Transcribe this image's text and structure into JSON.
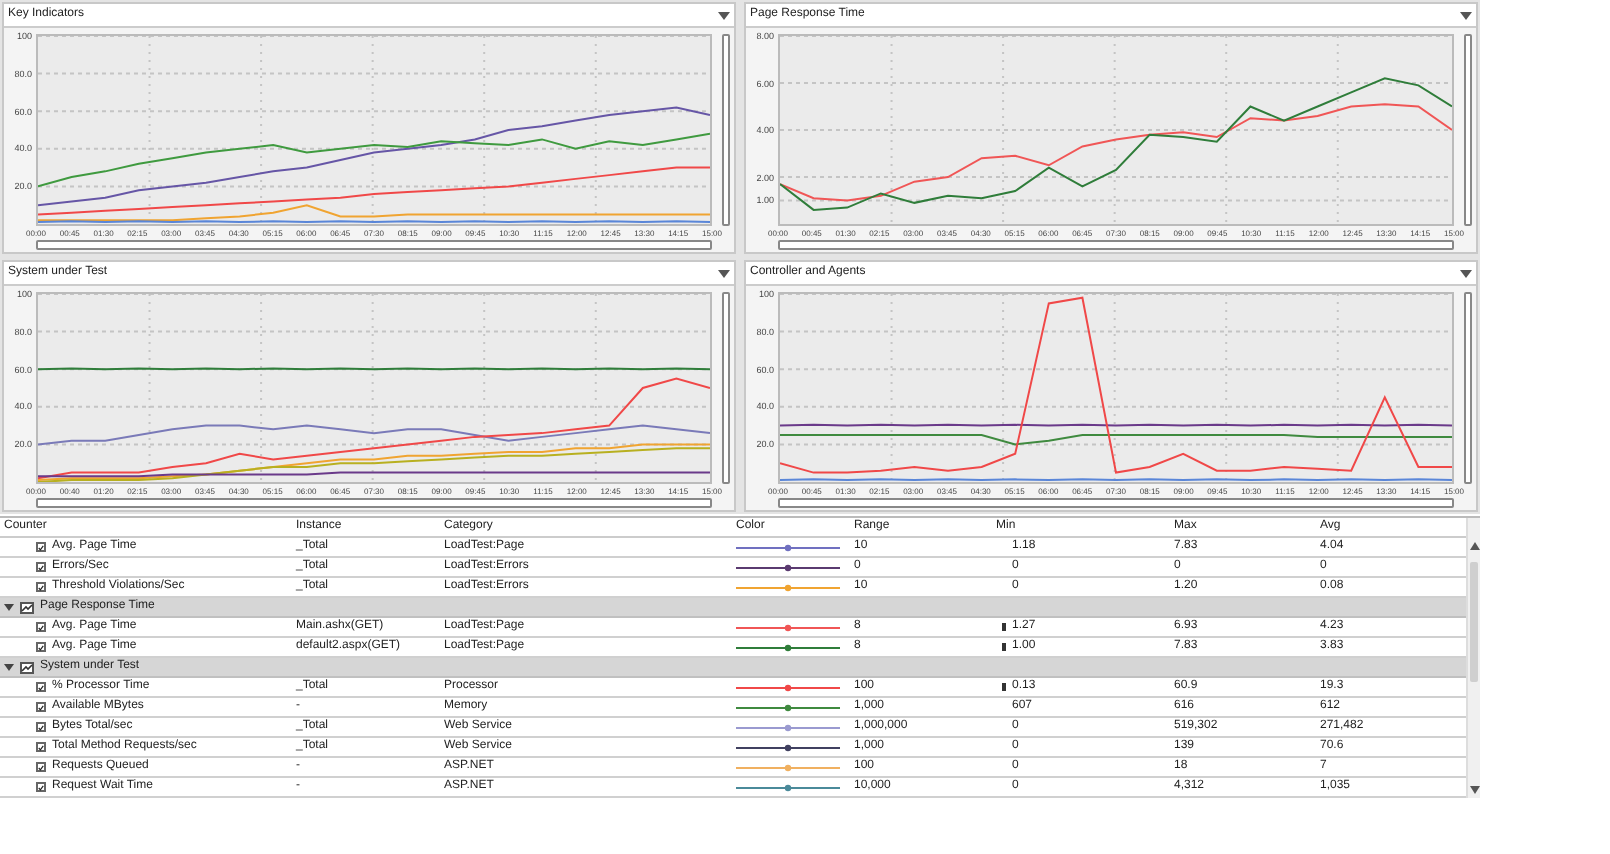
{
  "panels": [
    {
      "title": "Key Indicators",
      "chart_data": {
        "type": "line",
        "grid": true,
        "categories": [
          "00:00",
          "00:45",
          "01:30",
          "02:15",
          "03:00",
          "03:45",
          "04:30",
          "05:15",
          "06:00",
          "06:45",
          "07:30",
          "08:15",
          "09:00",
          "09:45",
          "10:30",
          "11:15",
          "12:00",
          "12:45",
          "13:30",
          "14:15",
          "15:00"
        ],
        "ylim": [
          0,
          100
        ],
        "yticks": [
          {
            "value": 100,
            "label": "100"
          },
          {
            "value": 80,
            "label": "80.0"
          },
          {
            "value": 60,
            "label": "60.0"
          },
          {
            "value": 40,
            "label": "40.0"
          },
          {
            "value": 20,
            "label": "20.0"
          }
        ],
        "series": [
          {
            "color": "#6656a6",
            "values": [
              10,
              12,
              14,
              18,
              20,
              22,
              25,
              28,
              30,
              34,
              38,
              40,
              42,
              45,
              50,
              52,
              55,
              58,
              60,
              62,
              58
            ]
          },
          {
            "color": "#3f9a3f",
            "values": [
              20,
              25,
              28,
              32,
              35,
              38,
              40,
              42,
              38,
              40,
              42,
              41,
              44,
              43,
              42,
              45,
              40,
              44,
              42,
              45,
              48
            ]
          },
          {
            "color": "#f04848",
            "values": [
              5,
              6,
              7,
              8,
              9,
              10,
              11,
              12,
              13,
              14,
              16,
              17,
              18,
              19,
              20,
              22,
              24,
              26,
              28,
              30,
              30
            ]
          },
          {
            "color": "#f0a431",
            "values": [
              2,
              2,
              2,
              2,
              2,
              3,
              4,
              6,
              10,
              4,
              4,
              5,
              5,
              5,
              5,
              5,
              5,
              5,
              5,
              5,
              5
            ]
          },
          {
            "color": "#5a86d8",
            "values": [
              1,
              1.4,
              1,
              1.4,
              1,
              1.4,
              1,
              1.4,
              1,
              1.4,
              1,
              1.4,
              1,
              1.4,
              1,
              1.4,
              1,
              1.4,
              1,
              1.4,
              1
            ]
          }
        ]
      }
    },
    {
      "title": "Page Response Time",
      "chart_data": {
        "type": "line",
        "grid": true,
        "categories": [
          "00:00",
          "00:45",
          "01:30",
          "02:15",
          "03:00",
          "03:45",
          "04:30",
          "05:15",
          "06:00",
          "06:45",
          "07:30",
          "08:15",
          "09:00",
          "09:45",
          "10:30",
          "11:15",
          "12:00",
          "12:45",
          "13:30",
          "14:15",
          "15:00"
        ],
        "ylim": [
          0,
          8
        ],
        "yticks": [
          {
            "value": 8,
            "label": "8.00"
          },
          {
            "value": 6,
            "label": "6.00"
          },
          {
            "value": 4,
            "label": "4.00"
          },
          {
            "value": 2,
            "label": "2.00"
          },
          {
            "value": 1,
            "label": "1.00"
          }
        ],
        "series": [
          {
            "color": "#f05656",
            "values": [
              1.7,
              1.1,
              1.0,
              1.2,
              1.8,
              2.0,
              2.8,
              2.9,
              2.5,
              3.3,
              3.6,
              3.8,
              3.9,
              3.7,
              4.5,
              4.4,
              4.6,
              5.0,
              5.1,
              5.0,
              4.0
            ]
          },
          {
            "color": "#2f7d3a",
            "values": [
              1.7,
              0.6,
              0.7,
              1.3,
              0.9,
              1.2,
              1.1,
              1.4,
              2.4,
              1.6,
              2.3,
              3.8,
              3.7,
              3.5,
              5.0,
              4.4,
              5.0,
              5.6,
              6.2,
              5.9,
              5.0
            ]
          }
        ]
      }
    },
    {
      "title": "System under Test",
      "chart_data": {
        "type": "line",
        "grid": true,
        "categories": [
          "00:00",
          "00:40",
          "01:20",
          "02:15",
          "03:00",
          "03:45",
          "04:30",
          "05:15",
          "06:00",
          "06:45",
          "07:30",
          "08:15",
          "09:00",
          "09:45",
          "10:30",
          "11:15",
          "12:00",
          "12:45",
          "13:30",
          "14:15",
          "15:00"
        ],
        "ylim": [
          0,
          100
        ],
        "yticks": [
          {
            "value": 100,
            "label": "100"
          },
          {
            "value": 80,
            "label": "80.0"
          },
          {
            "value": 60,
            "label": "60.0"
          },
          {
            "value": 40,
            "label": "40.0"
          },
          {
            "value": 20,
            "label": "20.0"
          }
        ],
        "series": [
          {
            "color": "#2f7d3a",
            "values": [
              60,
              60.4,
              60,
              60.4,
              60,
              60.4,
              60,
              60.4,
              60,
              60.4,
              60,
              60.4,
              60,
              60.4,
              60,
              60.4,
              60,
              60.4,
              60,
              60.4,
              60
            ]
          },
          {
            "color": "#7a7ab8",
            "values": [
              20,
              22,
              22,
              25,
              28,
              30,
              30,
              28,
              30,
              28,
              26,
              28,
              28,
              25,
              22,
              24,
              26,
              28,
              30,
              28,
              26
            ]
          },
          {
            "color": "#f04848",
            "values": [
              2,
              5,
              5,
              5,
              8,
              10,
              15,
              12,
              14,
              16,
              18,
              20,
              22,
              24,
              25,
              26,
              28,
              30,
              50,
              55,
              50
            ]
          },
          {
            "color": "#f0a431",
            "values": [
              1,
              2,
              2,
              2,
              3,
              4,
              6,
              8,
              10,
              12,
              12,
              14,
              14,
              15,
              16,
              16,
              18,
              18,
              20,
              20,
              20
            ]
          },
          {
            "color": "#b8b020",
            "values": [
              0,
              1,
              1,
              1,
              2,
              4,
              6,
              8,
              8,
              10,
              10,
              11,
              12,
              13,
              14,
              14,
              15,
              16,
              17,
              18,
              18
            ]
          },
          {
            "color": "#6a3a8a",
            "values": [
              3,
              3,
              3,
              3,
              4,
              4,
              4,
              4,
              4,
              5,
              5,
              5,
              5,
              5,
              5,
              5,
              5,
              5,
              5,
              5,
              5
            ]
          }
        ]
      }
    },
    {
      "title": "Controller and Agents",
      "chart_data": {
        "type": "line",
        "grid": true,
        "categories": [
          "00:00",
          "00:45",
          "01:30",
          "02:15",
          "03:00",
          "03:45",
          "04:30",
          "05:15",
          "06:00",
          "06:45",
          "07:30",
          "08:15",
          "09:00",
          "09:45",
          "10:30",
          "11:15",
          "12:00",
          "12:45",
          "13:30",
          "14:15",
          "15:00"
        ],
        "ylim": [
          0,
          100
        ],
        "yticks": [
          {
            "value": 100,
            "label": "100"
          },
          {
            "value": 80,
            "label": "80.0"
          },
          {
            "value": 60,
            "label": "60.0"
          },
          {
            "value": 40,
            "label": "40.0"
          },
          {
            "value": 20,
            "label": "20.0"
          }
        ],
        "series": [
          {
            "color": "#6a3a8a",
            "values": [
              30,
              30.4,
              30,
              30.4,
              30,
              30.4,
              30,
              30.4,
              30,
              30.4,
              30,
              30.4,
              30,
              30.4,
              30,
              30.4,
              30,
              30.4,
              30,
              30.4,
              30
            ]
          },
          {
            "color": "#3f8a3f",
            "values": [
              25,
              25,
              25,
              25,
              25,
              25,
              25,
              20,
              22,
              25,
              25,
              25,
              25,
              25,
              25,
              25,
              24,
              24,
              24,
              24,
              24
            ]
          },
          {
            "color": "#f04848",
            "values": [
              10,
              5,
              5,
              6,
              8,
              6,
              8,
              15,
              95,
              98,
              5,
              8,
              15,
              6,
              6,
              8,
              7,
              6,
              45,
              8,
              8
            ]
          },
          {
            "color": "#5a86d8",
            "values": [
              1,
              1.4,
              1,
              1.4,
              1,
              1.4,
              1,
              1.4,
              1,
              1.4,
              1,
              1.4,
              1,
              1.4,
              1,
              1.4,
              1,
              1.4,
              1,
              1.4,
              1
            ]
          }
        ]
      }
    }
  ],
  "table": {
    "columns": [
      "Counter",
      "Instance",
      "Category",
      "Color",
      "Range",
      "Min",
      "Max",
      "Avg"
    ],
    "rows": [
      {
        "kind": "counter",
        "checked": true,
        "counter": "Avg. Page Time",
        "instance": "_Total",
        "category": "LoadTest:Page",
        "color": "#7070c0",
        "range": "10",
        "warning": false,
        "min": "1.18",
        "max": "7.83",
        "avg": "4.04"
      },
      {
        "kind": "counter",
        "checked": true,
        "counter": "Errors/Sec",
        "instance": "_Total",
        "category": "LoadTest:Errors",
        "color": "#5a3a70",
        "range": "0",
        "warning": false,
        "min": "0",
        "max": "0",
        "avg": "0"
      },
      {
        "kind": "counter",
        "checked": true,
        "counter": "Threshold Violations/Sec",
        "instance": "_Total",
        "category": "LoadTest:Errors",
        "color": "#f0a431",
        "range": "10",
        "warning": false,
        "min": "0",
        "max": "1.20",
        "avg": "0.08"
      },
      {
        "kind": "group",
        "label": "Page Response Time",
        "expanded": true
      },
      {
        "kind": "counter",
        "checked": true,
        "counter": "Avg. Page Time",
        "instance": "Main.ashx(GET)",
        "category": "LoadTest:Page",
        "color": "#f05656",
        "range": "8",
        "warning": true,
        "min": "1.27",
        "max": "6.93",
        "avg": "4.23"
      },
      {
        "kind": "counter",
        "checked": true,
        "counter": "Avg. Page Time",
        "instance": "default2.aspx(GET)",
        "category": "LoadTest:Page",
        "color": "#2f7d3a",
        "range": "8",
        "warning": true,
        "min": "1.00",
        "max": "7.83",
        "avg": "3.83"
      },
      {
        "kind": "group",
        "label": "System under Test",
        "expanded": true
      },
      {
        "kind": "counter",
        "checked": true,
        "counter": "% Processor Time",
        "instance": "_Total",
        "category": "Processor",
        "color": "#f04848",
        "range": "100",
        "warning": true,
        "min": "0.13",
        "max": "60.9",
        "avg": "19.3"
      },
      {
        "kind": "counter",
        "checked": true,
        "counter": "Available MBytes",
        "instance": "-",
        "category": "Memory",
        "color": "#3f8a3f",
        "range": "1,000",
        "warning": false,
        "min": "607",
        "max": "616",
        "avg": "612"
      },
      {
        "kind": "counter",
        "checked": true,
        "counter": "Bytes Total/sec",
        "instance": "_Total",
        "category": "Web Service",
        "color": "#9a9ad0",
        "range": "1,000,000",
        "warning": false,
        "min": "0",
        "max": "519,302",
        "avg": "271,482"
      },
      {
        "kind": "counter",
        "checked": true,
        "counter": "Total Method Requests/sec",
        "instance": "_Total",
        "category": "Web Service",
        "color": "#404060",
        "range": "1,000",
        "warning": false,
        "min": "0",
        "max": "139",
        "avg": "70.6"
      },
      {
        "kind": "counter",
        "checked": true,
        "counter": "Requests Queued",
        "instance": "-",
        "category": "ASP.NET",
        "color": "#f0b060",
        "range": "100",
        "warning": false,
        "min": "0",
        "max": "18",
        "avg": "7"
      },
      {
        "kind": "counter",
        "checked": true,
        "counter": "Request Wait Time",
        "instance": "-",
        "category": "ASP.NET",
        "color": "#4a8a9a",
        "range": "10,000",
        "warning": false,
        "min": "0",
        "max": "4,312",
        "avg": "1,035"
      }
    ]
  }
}
